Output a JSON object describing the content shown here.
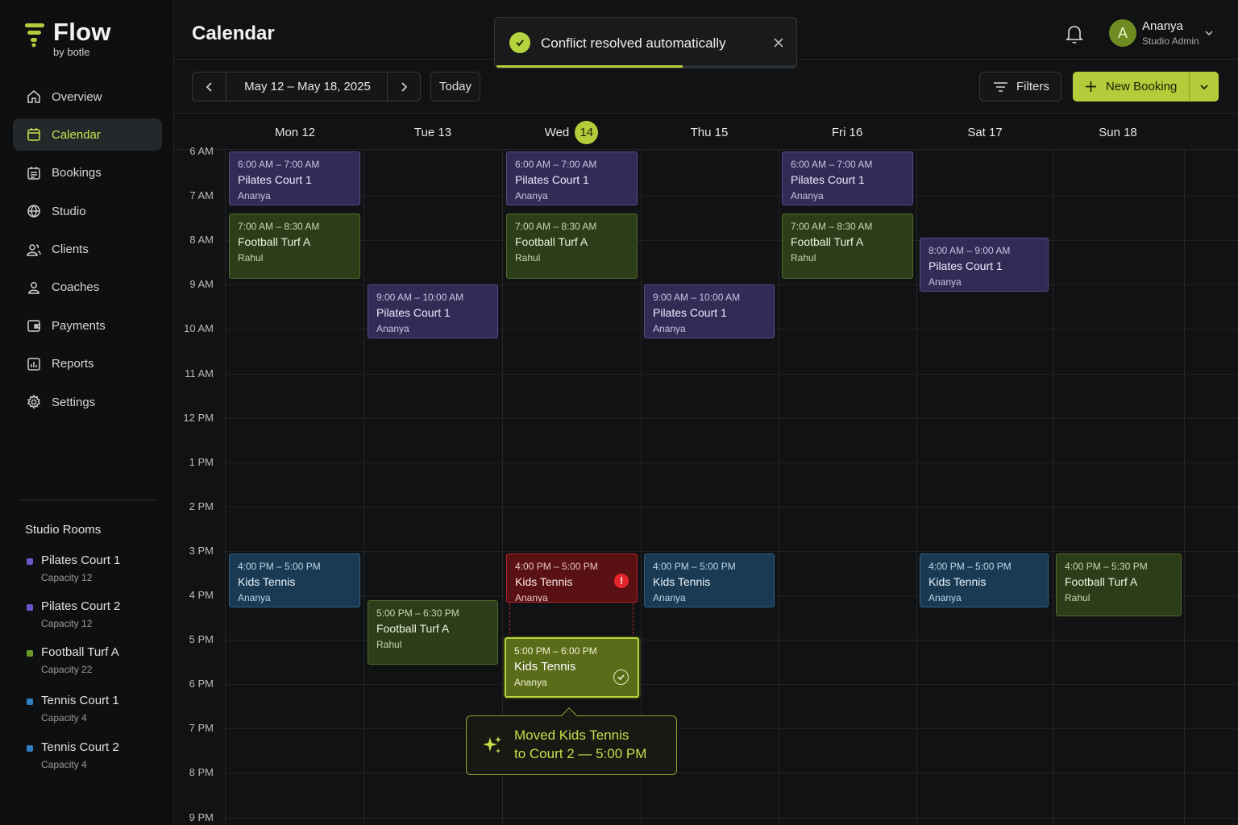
{
  "app": {
    "brand_name": "Flow",
    "brand_sub": "by botle",
    "accent": "#b3cc3a"
  },
  "sidebar": {
    "items": [
      {
        "label": "Overview",
        "icon": "home-icon",
        "active": false
      },
      {
        "label": "Calendar",
        "icon": "calendar-icon",
        "active": true
      },
      {
        "label": "Bookings",
        "icon": "bookings-icon",
        "active": false
      },
      {
        "label": "Studio",
        "icon": "globe-icon",
        "active": false
      },
      {
        "label": "Clients",
        "icon": "users-icon",
        "active": false
      },
      {
        "label": "Coaches",
        "icon": "user-icon",
        "active": false
      },
      {
        "label": "Payments",
        "icon": "wallet-icon",
        "active": false
      },
      {
        "label": "Reports",
        "icon": "chart-icon",
        "active": false
      },
      {
        "label": "Settings",
        "icon": "gear-icon",
        "active": false
      }
    ],
    "rooms_title": "Studio Rooms",
    "rooms": [
      {
        "name": "Pilates Court 1",
        "capacity": "Capacity 12",
        "color": "#6b57c9"
      },
      {
        "name": "Pilates Court 2",
        "capacity": "Capacity 12",
        "color": "#6b57c9"
      },
      {
        "name": "Football Turf A",
        "capacity": "Capacity 22",
        "color": "#6c9a2a"
      },
      {
        "name": "Tennis Court 1",
        "capacity": "Capacity 4",
        "color": "#2f7fc0"
      },
      {
        "name": "Tennis Court 2",
        "capacity": "Capacity 4",
        "color": "#2f7fc0"
      }
    ]
  },
  "header": {
    "title": "Calendar",
    "user_name": "Ananya",
    "user_role": "Studio Admin",
    "avatar_initial": "A"
  },
  "toast": {
    "text": "Conflict resolved automatically",
    "progress": 0.62
  },
  "toolbar": {
    "date_range": "May 12 – May 18, 2025",
    "today_label": "Today",
    "filters_label": "Filters",
    "new_booking_label": "New Booking"
  },
  "calendar": {
    "days": [
      {
        "label": "Mon 12",
        "today": false
      },
      {
        "label": "Tue 13",
        "today": false
      },
      {
        "label": "Wed",
        "today": true,
        "badge": "14"
      },
      {
        "label": "Thu 15",
        "today": false
      },
      {
        "label": "Fri 16",
        "today": false
      },
      {
        "label": "Sat 17",
        "today": false
      },
      {
        "label": "Sun 18",
        "today": false
      }
    ],
    "hours": [
      "6 AM",
      "7 AM",
      "8 AM",
      "9 AM",
      "10 AM",
      "11 AM",
      "12 PM",
      "1 PM",
      "2 PM",
      "3 PM",
      "4 PM",
      "5 PM",
      "6 PM",
      "7 PM",
      "8 PM",
      "9 PM"
    ],
    "events": [
      {
        "day": 0,
        "start": 6.0,
        "end": 7.25,
        "time": "6:00 AM – 7:00 AM",
        "title": "Pilates Court 1",
        "person": "Ananya",
        "style": "purple"
      },
      {
        "day": 0,
        "start": 7.4,
        "end": 8.9,
        "time": "7:00 AM – 8:30 AM",
        "title": "Football Turf A",
        "person": "Rahul",
        "style": "green"
      },
      {
        "day": 0,
        "start": 15.05,
        "end": 16.3,
        "time": "4:00 PM – 5:00 PM",
        "title": "Kids Tennis",
        "person": "Ananya",
        "style": "blue"
      },
      {
        "day": 1,
        "start": 9.0,
        "end": 10.25,
        "time": "9:00 AM – 10:00 AM",
        "title": "Pilates Court 1",
        "person": "Ananya",
        "style": "purple"
      },
      {
        "day": 1,
        "start": 16.1,
        "end": 17.6,
        "time": "5:00 PM – 6:30 PM",
        "title": "Football Turf A",
        "person": "Rahul",
        "style": "green"
      },
      {
        "day": 2,
        "start": 6.0,
        "end": 7.25,
        "time": "6:00 AM – 7:00 AM",
        "title": "Pilates Court 1",
        "person": "Ananya",
        "style": "purple"
      },
      {
        "day": 2,
        "start": 7.4,
        "end": 8.9,
        "time": "7:00 AM – 8:30 AM",
        "title": "Football Turf A",
        "person": "Rahul",
        "style": "green"
      },
      {
        "day": 2,
        "start": 15.05,
        "end": 16.2,
        "time": "4:00 PM – 5:00 PM",
        "title": "Kids Tennis",
        "person": "Ananya",
        "style": "red",
        "flag": "alert"
      },
      {
        "day": 2,
        "start": 16.95,
        "end": 18.35,
        "time": "5:00 PM – 6:00 PM",
        "title": "Kids Tennis",
        "person": "Ananya",
        "style": "lime",
        "flag": "ok"
      },
      {
        "day": 3,
        "start": 9.0,
        "end": 10.25,
        "time": "9:00 AM – 10:00 AM",
        "title": "Pilates Court 1",
        "person": "Ananya",
        "style": "purple"
      },
      {
        "day": 3,
        "start": 15.05,
        "end": 16.3,
        "time": "4:00 PM – 5:00 PM",
        "title": "Kids Tennis",
        "person": "Ananya",
        "style": "blue"
      },
      {
        "day": 4,
        "start": 6.0,
        "end": 7.25,
        "time": "6:00 AM – 7:00 AM",
        "title": "Pilates Court 1",
        "person": "Ananya",
        "style": "purple"
      },
      {
        "day": 4,
        "start": 7.4,
        "end": 8.9,
        "time": "7:00 AM – 8:30 AM",
        "title": "Football Turf A",
        "person": "Rahul",
        "style": "green"
      },
      {
        "day": 5,
        "start": 7.95,
        "end": 9.2,
        "time": "8:00 AM – 9:00 AM",
        "title": "Pilates Court 1",
        "person": "Ananya",
        "style": "purple"
      },
      {
        "day": 5,
        "start": 15.05,
        "end": 16.3,
        "time": "4:00 PM – 5:00 PM",
        "title": "Kids Tennis",
        "person": "Ananya",
        "style": "blue"
      },
      {
        "day": 6,
        "start": 15.05,
        "end": 16.5,
        "time": "4:00 PM – 5:30 PM",
        "title": "Football Turf A",
        "person": "Rahul",
        "style": "green"
      }
    ]
  },
  "popover": {
    "line1": "Moved Kids Tennis",
    "line2": "to Court 2 — 5:00 PM"
  }
}
